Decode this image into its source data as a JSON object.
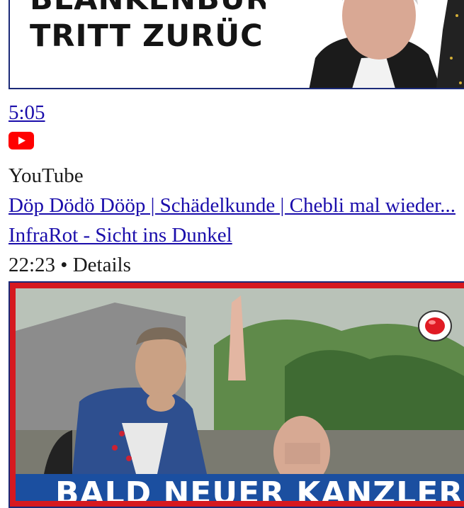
{
  "results": [
    {
      "thumbnail_caption": "TRITT ZURÜCK!",
      "duration": "5:05"
    },
    {
      "source": "YouTube",
      "title": "Döp Dödö Dööp | Schädelkunde | Chebli mal wieder...",
      "channel": "InfraRot - Sicht ins Dunkel",
      "meta": "22:23 • Details",
      "thumbnail_caption": "BALD NEUER KANZLER?"
    }
  ],
  "icons": {
    "source_icon": "youtube-icon",
    "record_icon": "record-icon"
  },
  "colors": {
    "link": "#1a0dab",
    "youtube_red": "#ff0000",
    "thumb_border": "#1b2a78",
    "banner_blue": "#1b4fa0",
    "thumb_red": "#d6191f"
  }
}
